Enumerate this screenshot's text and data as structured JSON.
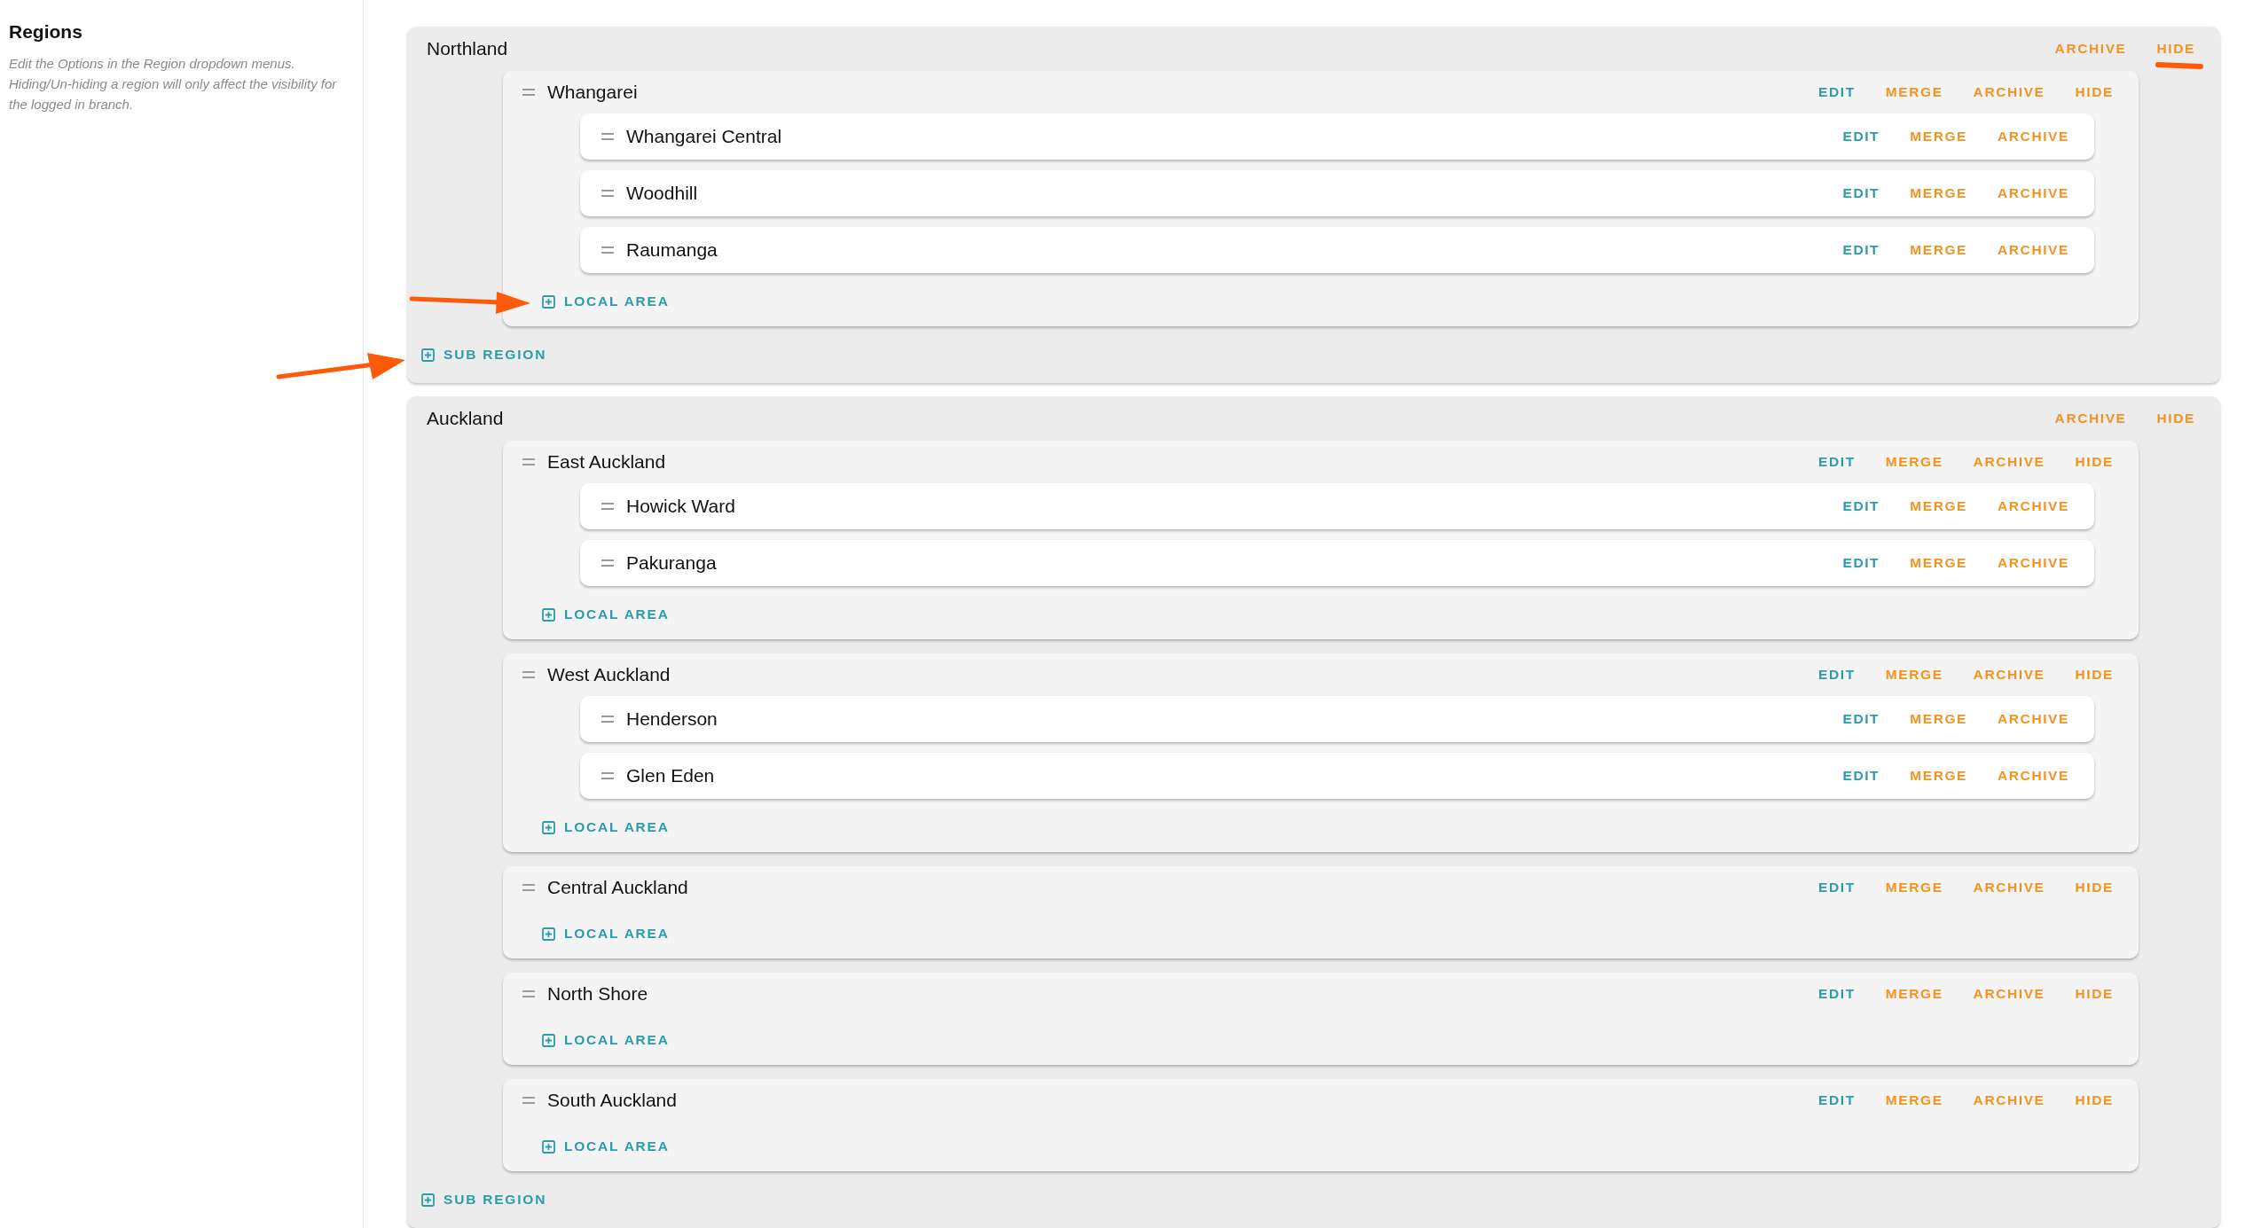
{
  "sidebar": {
    "title": "Regions",
    "description": "Edit the Options in the Region dropdown menus. Hiding/Un-hiding a region will only affect the visibility for the logged in branch."
  },
  "regions": [
    {
      "name": "Northland",
      "actions": [
        {
          "label": "ARCHIVE",
          "color": "#f39322"
        },
        {
          "label": "HIDE",
          "color": "#f39322"
        }
      ],
      "add_label": "SUB REGION",
      "sub_regions": [
        {
          "name": "Whangarei",
          "actions": [
            {
              "label": "EDIT",
              "color": "#2b9cab"
            },
            {
              "label": "MERGE",
              "color": "#f39322"
            },
            {
              "label": "ARCHIVE",
              "color": "#f39322"
            },
            {
              "label": "HIDE",
              "color": "#f39322"
            }
          ],
          "add_label": "LOCAL AREA",
          "local_areas": [
            {
              "name": "Whangarei Central",
              "actions": [
                {
                  "label": "EDIT",
                  "color": "#2b9cab"
                },
                {
                  "label": "MERGE",
                  "color": "#f39322"
                },
                {
                  "label": "ARCHIVE",
                  "color": "#f39322"
                }
              ]
            },
            {
              "name": "Woodhill",
              "actions": [
                {
                  "label": "EDIT",
                  "color": "#2b9cab"
                },
                {
                  "label": "MERGE",
                  "color": "#f39322"
                },
                {
                  "label": "ARCHIVE",
                  "color": "#f39322"
                }
              ]
            },
            {
              "name": "Raumanga",
              "actions": [
                {
                  "label": "EDIT",
                  "color": "#2b9cab"
                },
                {
                  "label": "MERGE",
                  "color": "#f39322"
                },
                {
                  "label": "ARCHIVE",
                  "color": "#f39322"
                }
              ]
            }
          ]
        }
      ]
    },
    {
      "name": "Auckland",
      "actions": [
        {
          "label": "ARCHIVE",
          "color": "#f39322"
        },
        {
          "label": "HIDE",
          "color": "#f39322"
        }
      ],
      "add_label": "SUB REGION",
      "sub_regions": [
        {
          "name": "East Auckland",
          "actions": [
            {
              "label": "EDIT",
              "color": "#2b9cab"
            },
            {
              "label": "MERGE",
              "color": "#f39322"
            },
            {
              "label": "ARCHIVE",
              "color": "#f39322"
            },
            {
              "label": "HIDE",
              "color": "#f39322"
            }
          ],
          "add_label": "LOCAL AREA",
          "local_areas": [
            {
              "name": "Howick Ward",
              "actions": [
                {
                  "label": "EDIT",
                  "color": "#2b9cab"
                },
                {
                  "label": "MERGE",
                  "color": "#f39322"
                },
                {
                  "label": "ARCHIVE",
                  "color": "#f39322"
                }
              ]
            },
            {
              "name": "Pakuranga",
              "actions": [
                {
                  "label": "EDIT",
                  "color": "#2b9cab"
                },
                {
                  "label": "MERGE",
                  "color": "#f39322"
                },
                {
                  "label": "ARCHIVE",
                  "color": "#f39322"
                }
              ]
            }
          ]
        },
        {
          "name": "West Auckland",
          "actions": [
            {
              "label": "EDIT",
              "color": "#2b9cab"
            },
            {
              "label": "MERGE",
              "color": "#f39322"
            },
            {
              "label": "ARCHIVE",
              "color": "#f39322"
            },
            {
              "label": "HIDE",
              "color": "#f39322"
            }
          ],
          "add_label": "LOCAL AREA",
          "local_areas": [
            {
              "name": "Henderson",
              "actions": [
                {
                  "label": "EDIT",
                  "color": "#2b9cab"
                },
                {
                  "label": "MERGE",
                  "color": "#f39322"
                },
                {
                  "label": "ARCHIVE",
                  "color": "#f39322"
                }
              ]
            },
            {
              "name": "Glen Eden",
              "actions": [
                {
                  "label": "EDIT",
                  "color": "#2b9cab"
                },
                {
                  "label": "MERGE",
                  "color": "#f39322"
                },
                {
                  "label": "ARCHIVE",
                  "color": "#f39322"
                }
              ]
            }
          ]
        },
        {
          "name": "Central Auckland",
          "actions": [
            {
              "label": "EDIT",
              "color": "#2b9cab"
            },
            {
              "label": "MERGE",
              "color": "#f39322"
            },
            {
              "label": "ARCHIVE",
              "color": "#f39322"
            },
            {
              "label": "HIDE",
              "color": "#f39322"
            }
          ],
          "add_label": "LOCAL AREA"
        },
        {
          "name": "North Shore",
          "actions": [
            {
              "label": "EDIT",
              "color": "#2b9cab"
            },
            {
              "label": "MERGE",
              "color": "#f39322"
            },
            {
              "label": "ARCHIVE",
              "color": "#f39322"
            },
            {
              "label": "HIDE",
              "color": "#f39322"
            }
          ],
          "add_label": "LOCAL AREA"
        },
        {
          "name": "South Auckland",
          "actions": [
            {
              "label": "EDIT",
              "color": "#2b9cab"
            },
            {
              "label": "MERGE",
              "color": "#f39322"
            },
            {
              "label": "ARCHIVE",
              "color": "#f39322"
            },
            {
              "label": "HIDE",
              "color": "#f39322"
            }
          ],
          "add_label": "LOCAL AREA"
        }
      ]
    }
  ]
}
